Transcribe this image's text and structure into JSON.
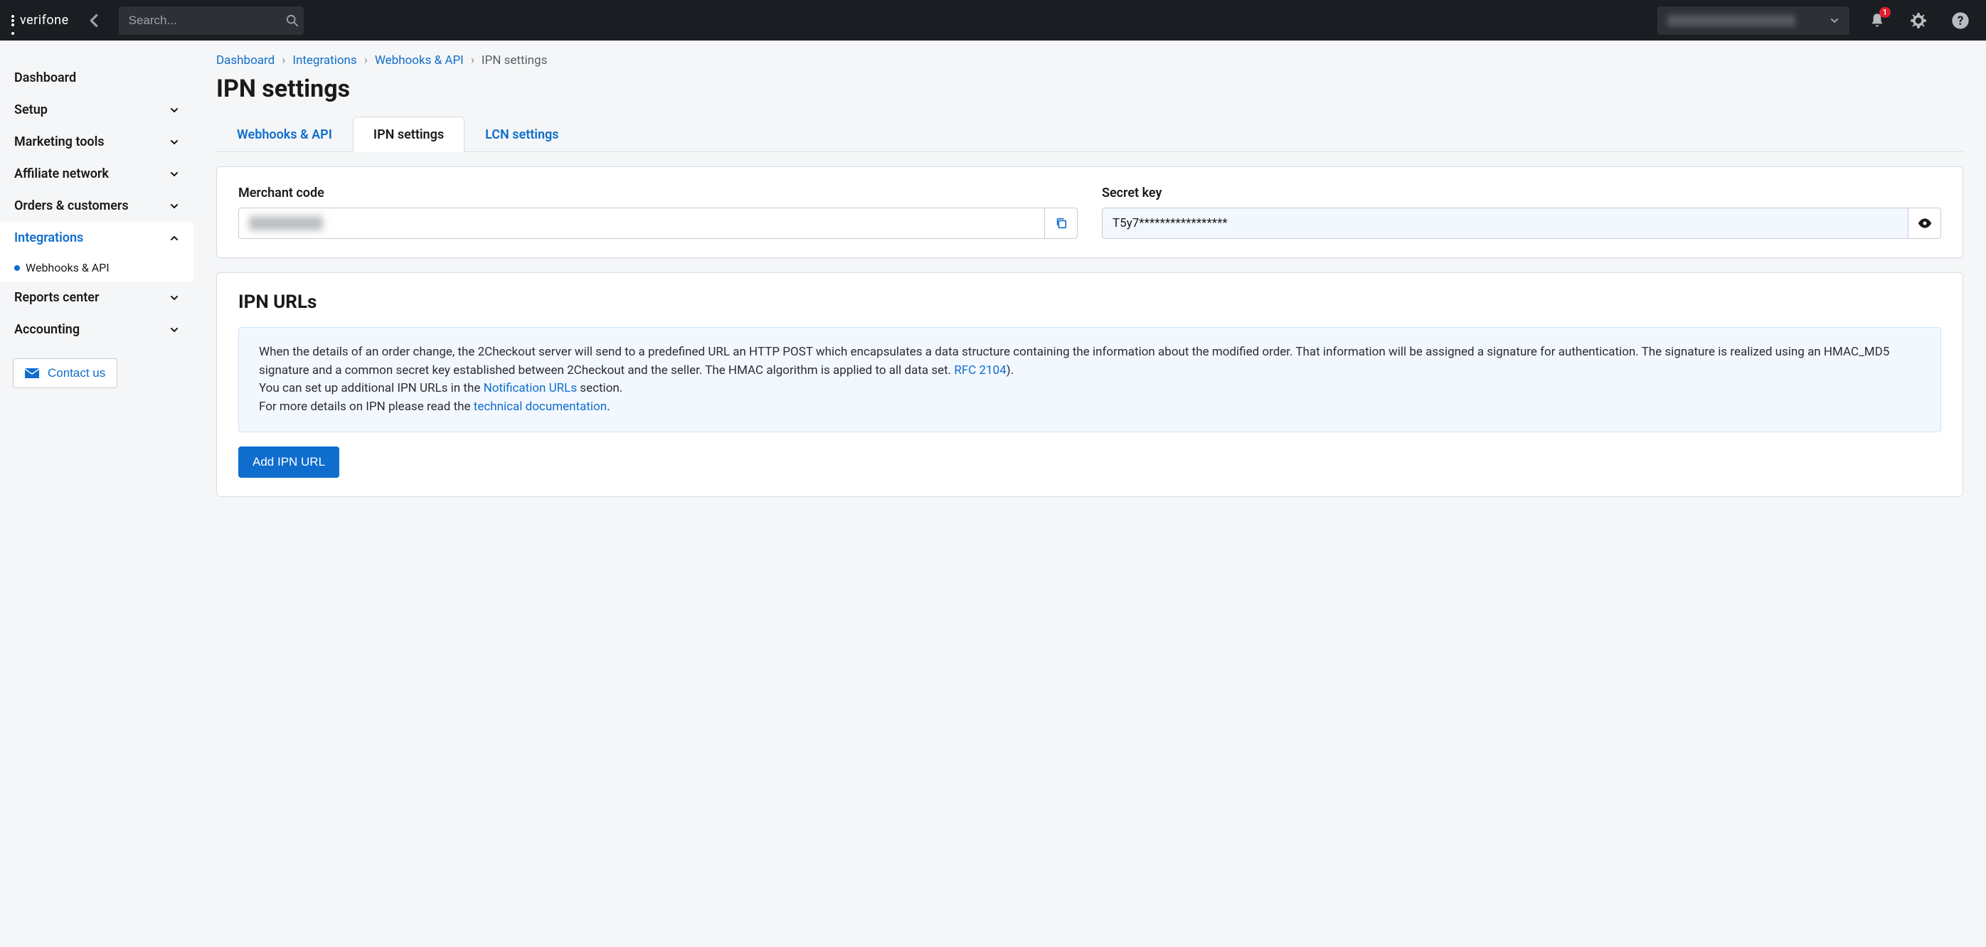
{
  "brand": "verifone",
  "search": {
    "placeholder": "Search..."
  },
  "notifications": {
    "count": "1"
  },
  "breadcrumb": [
    {
      "label": "Dashboard",
      "link": true
    },
    {
      "label": "Integrations",
      "link": true
    },
    {
      "label": "Webhooks & API",
      "link": true
    },
    {
      "label": "IPN settings",
      "link": false
    }
  ],
  "page_title": "IPN settings",
  "tabs": [
    {
      "label": "Webhooks & API",
      "active": false
    },
    {
      "label": "IPN settings",
      "active": true
    },
    {
      "label": "LCN settings",
      "active": false
    }
  ],
  "fields": {
    "merchant_code": {
      "label": "Merchant code",
      "value": ""
    },
    "secret_key": {
      "label": "Secret key",
      "value": "T5y7*****************"
    }
  },
  "ipn_section": {
    "title": "IPN URLs",
    "info_p1a": "When the details of an order change, the 2Checkout server will send to a predefined URL an HTTP POST which encapsulates a data structure containing the information about the modified order. That information will be assigned a signature for authentication. The signature is realized using an HMAC_MD5 signature and a common secret key established between 2Checkout and the seller. The HMAC algorithm is applied to all data set. ",
    "link_rfc": "RFC 2104",
    "info_p1b": ").",
    "info_p2a": "You can set up additional IPN URLs in the ",
    "link_notif": "Notification URLs",
    "info_p2b": " section.",
    "info_p3a": "For more details on IPN please read the ",
    "link_doc": "technical documentation",
    "info_p3b": ".",
    "button": "Add IPN URL"
  },
  "sidebar": {
    "items": [
      {
        "label": "Dashboard",
        "expandable": false
      },
      {
        "label": "Setup",
        "expandable": true
      },
      {
        "label": "Marketing tools",
        "expandable": true
      },
      {
        "label": "Affiliate network",
        "expandable": true
      },
      {
        "label": "Orders & customers",
        "expandable": true
      },
      {
        "label": "Integrations",
        "expandable": true,
        "active": true,
        "expanded": true
      },
      {
        "label": "Reports center",
        "expandable": true
      },
      {
        "label": "Accounting",
        "expandable": true
      }
    ],
    "sub_webhooks": "Webhooks & API",
    "contact": "Contact us"
  }
}
